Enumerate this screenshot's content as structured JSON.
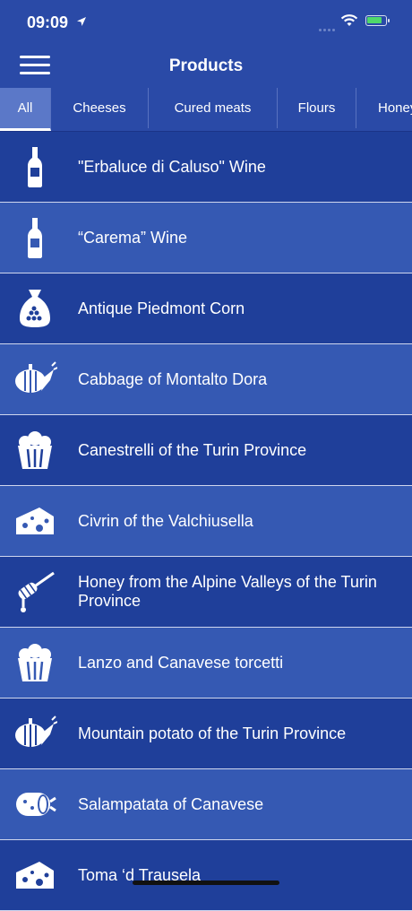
{
  "status": {
    "time": "09:09"
  },
  "nav": {
    "title": "Products"
  },
  "tabs": [
    {
      "label": "All"
    },
    {
      "label": "Cheeses"
    },
    {
      "label": "Cured meats"
    },
    {
      "label": "Flours"
    },
    {
      "label": "Honey"
    }
  ],
  "products": [
    {
      "name": "\"Erbaluce di Caluso\" Wine",
      "icon": "wine-bottle-icon"
    },
    {
      "name": "“Carema” Wine",
      "icon": "wine-bottle-icon"
    },
    {
      "name": "Antique Piedmont Corn",
      "icon": "grain-sack-icon"
    },
    {
      "name": "Cabbage of Montalto Dora",
      "icon": "vegetables-icon"
    },
    {
      "name": "Canestrelli of the Turin Province",
      "icon": "popcorn-basket-icon"
    },
    {
      "name": "Civrin of the Valchiusella",
      "icon": "cheese-icon"
    },
    {
      "name": "Honey from the Alpine Valleys of the Turin Province",
      "icon": "honey-dipper-icon"
    },
    {
      "name": "Lanzo and Canavese torcetti",
      "icon": "popcorn-basket-icon"
    },
    {
      "name": "Mountain potato of the Turin Province",
      "icon": "vegetables-icon"
    },
    {
      "name": "Salampatata of Canavese",
      "icon": "salami-icon"
    },
    {
      "name": "Toma ‘d Trausela",
      "icon": "cheese-icon"
    }
  ],
  "colors": {
    "accent": "#1f3f9a",
    "row_alt": "#3559b3",
    "tab_active": "#5b78c8"
  }
}
